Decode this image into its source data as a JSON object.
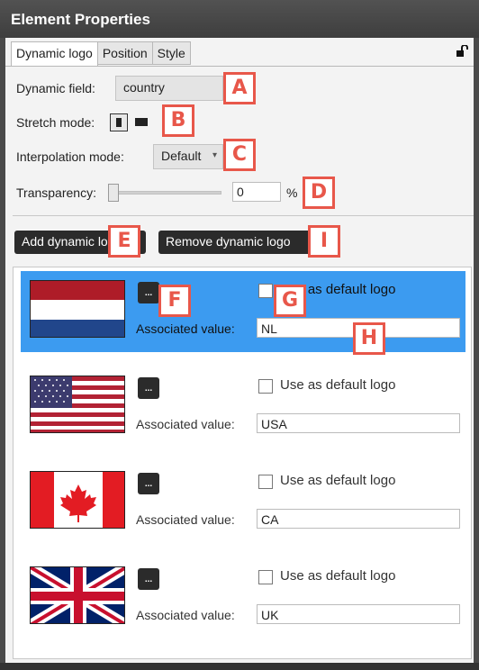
{
  "window": {
    "title": "Element Properties"
  },
  "tabs": [
    {
      "label": "Dynamic logo",
      "active": true
    },
    {
      "label": "Position",
      "active": false
    },
    {
      "label": "Style",
      "active": false
    }
  ],
  "fields": {
    "dynamic_field_label": "Dynamic field:",
    "dynamic_field_value": "country",
    "stretch_mode_label": "Stretch mode:",
    "interpolation_label": "Interpolation mode:",
    "interpolation_value": "Default",
    "transparency_label": "Transparency:",
    "transparency_value": "0",
    "transparency_unit": "%",
    "transparency_level": 0
  },
  "buttons": {
    "add": "Add dynamic logo",
    "remove": "Remove dynamic logo",
    "browse": "..."
  },
  "logos": [
    {
      "flag": "netherlands",
      "default_label": "Use as default logo",
      "assoc_label": "Associated value:",
      "value": "NL",
      "selected": true,
      "checked": false
    },
    {
      "flag": "usa",
      "default_label": "Use as default logo",
      "assoc_label": "Associated value:",
      "value": "USA",
      "selected": false,
      "checked": false
    },
    {
      "flag": "canada",
      "default_label": "Use as default logo",
      "assoc_label": "Associated value:",
      "value": "CA",
      "selected": false,
      "checked": false
    },
    {
      "flag": "uk",
      "default_label": "Use as default logo",
      "assoc_label": "Associated value:",
      "value": "UK",
      "selected": false,
      "checked": false
    }
  ],
  "callouts": [
    "A",
    "B",
    "C",
    "D",
    "E",
    "F",
    "G",
    "H",
    "I"
  ],
  "colors": {
    "selection": "#3c9bf0",
    "callout": "#e8574a",
    "titlebar": "#444444"
  }
}
